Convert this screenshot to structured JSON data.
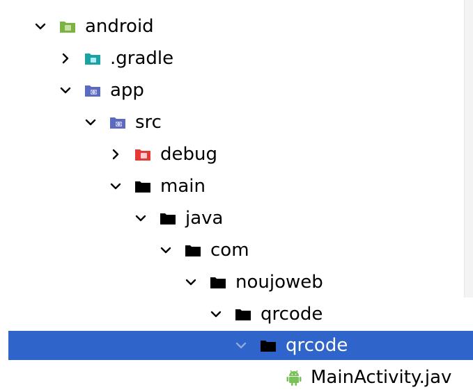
{
  "colors": {
    "selected_row": "#2f65ca",
    "selected_text": "#ffffff",
    "android_module_folder": "#7cb342",
    "gradle_folder": "#1ba3a3",
    "source_folder": "#5c6bc0",
    "debug_folder": "#e53935",
    "package_folder": "#000000",
    "android_icon": "#78c257",
    "chevron": "#000000"
  },
  "tree": {
    "nodes": [
      {
        "label": "android",
        "state": "expanded",
        "icon": "android-module-folder-icon"
      },
      {
        "label": ".gradle",
        "state": "collapsed",
        "icon": "gradle-folder-icon"
      },
      {
        "label": "app",
        "state": "expanded",
        "icon": "source-module-folder-icon"
      },
      {
        "label": "src",
        "state": "expanded",
        "icon": "source-module-folder-icon"
      },
      {
        "label": "debug",
        "state": "collapsed",
        "icon": "debug-folder-icon"
      },
      {
        "label": "main",
        "state": "expanded",
        "icon": "folder-icon"
      },
      {
        "label": "java",
        "state": "expanded",
        "icon": "folder-icon"
      },
      {
        "label": "com",
        "state": "expanded",
        "icon": "folder-icon"
      },
      {
        "label": "noujoweb",
        "state": "expanded",
        "icon": "folder-icon"
      },
      {
        "label": "qrcode",
        "state": "expanded",
        "icon": "folder-icon"
      },
      {
        "label": "qrcode",
        "state": "expanded",
        "icon": "folder-icon",
        "selected": true
      },
      {
        "label": "MainActivity.jav",
        "state": "leaf",
        "icon": "android-icon"
      }
    ]
  }
}
